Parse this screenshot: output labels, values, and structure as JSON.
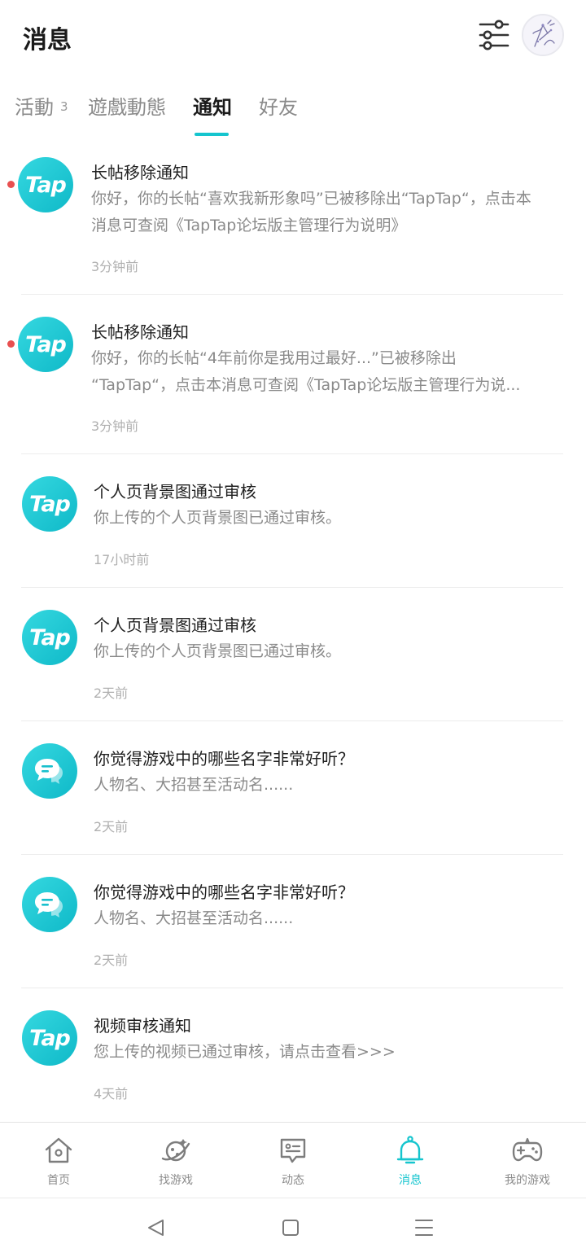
{
  "header": {
    "title": "消息",
    "filter_icon": "sliders-icon",
    "avatar": "user-avatar"
  },
  "tabs": [
    {
      "label": "活動",
      "badge": "3",
      "active": false
    },
    {
      "label": "遊戲動態",
      "active": false
    },
    {
      "label": "通知",
      "active": true
    },
    {
      "label": "好友",
      "active": false
    }
  ],
  "notifications": [
    {
      "logo": "tap-logo",
      "logo_text": "Tap",
      "unread": true,
      "title": "长帖移除通知",
      "body_line1": "你好，你的长帖“喜欢我新形象吗”已被移除出“TapTap“，点击本",
      "body_line2": "消息可查阅《TapTap论坛版主管理行为说明》",
      "time": "3分钟前"
    },
    {
      "logo": "tap-logo",
      "logo_text": "Tap",
      "unread": true,
      "title": "长帖移除通知",
      "body_line1": "你好，你的长帖“4年前你是我用过最好...”已被移除出",
      "body_line2": "“TapTap“，点击本消息可查阅《TapTap论坛版主管理行为说...",
      "time": "3分钟前"
    },
    {
      "logo": "tap-logo",
      "logo_text": "Tap",
      "unread": false,
      "title": "个人页背景图通过审核",
      "body_line1": "你上传的个人页背景图已通过审核。",
      "time": "17小时前"
    },
    {
      "logo": "tap-logo",
      "logo_text": "Tap",
      "unread": false,
      "title": "个人页背景图通过审核",
      "body_line1": "你上传的个人页背景图已通过审核。",
      "time": "2天前"
    },
    {
      "logo": "chat-bubble-icon",
      "unread": false,
      "title": "你觉得游戏中的哪些名字非常好听？",
      "body_line1": "人物名、大招甚至活动名......",
      "time": "2天前"
    },
    {
      "logo": "chat-bubble-icon",
      "unread": false,
      "title": "你觉得游戏中的哪些名字非常好听？",
      "body_line1": "人物名、大招甚至活动名......",
      "time": "2天前"
    },
    {
      "logo": "tap-logo",
      "logo_text": "Tap",
      "unread": false,
      "title": "视频审核通知",
      "body_line1": "您上传的视频已通过审核，请点击查看>>>",
      "time": "4天前"
    }
  ],
  "bottom_nav": [
    {
      "label": "首页",
      "icon": "home-icon",
      "active": false
    },
    {
      "label": "找游戏",
      "icon": "planet-icon",
      "active": false
    },
    {
      "label": "动态",
      "icon": "chat-box-icon",
      "active": false
    },
    {
      "label": "消息",
      "icon": "bell-icon",
      "active": true
    },
    {
      "label": "我的游戏",
      "icon": "gamepad-icon",
      "active": false
    }
  ],
  "colors": {
    "accent": "#15c5ce",
    "unread_dot": "#e85050",
    "title": "#1a1a1a",
    "secondary_text": "#8a8a8a"
  }
}
